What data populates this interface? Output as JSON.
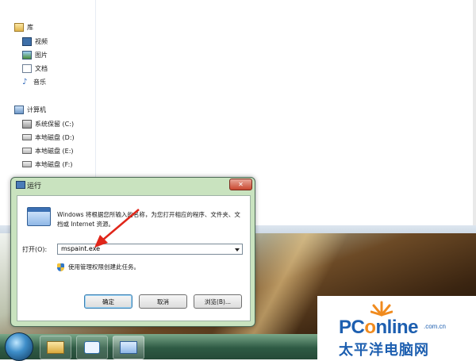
{
  "explorer": {
    "nav": {
      "library": "库",
      "library_items": [
        "视频",
        "图片",
        "文档",
        "音乐"
      ],
      "computer": "计算机",
      "drives": [
        "系统保留 (C:)",
        "本地磁盘 (D:)",
        "本地磁盘 (E:)",
        "本地磁盘 (F:)"
      ]
    }
  },
  "run_dialog": {
    "title": "运行",
    "close_glyph": "✕",
    "description": "Windows 将根据您所输入的名称，为您打开相应的程序、文件夹、文档或 Internet 资源。",
    "open_label": "打开(O):",
    "open_value": "mspaint.exe",
    "admin_note": "使用管理权限创建此任务。",
    "buttons": {
      "ok": "确定",
      "cancel": "取消",
      "browse": "浏览(B)..."
    }
  },
  "watermark": {
    "brand_prefix": "PC",
    "brand_o": "o",
    "brand_rest": "nline",
    "domain": ".com.cn",
    "subtitle": "太平洋电脑网"
  },
  "colors": {
    "dialog_frame": "#c9e3bf",
    "taskbar": "#2e5a44",
    "arrow": "#e0261a",
    "brand": "#1d5fb0"
  }
}
